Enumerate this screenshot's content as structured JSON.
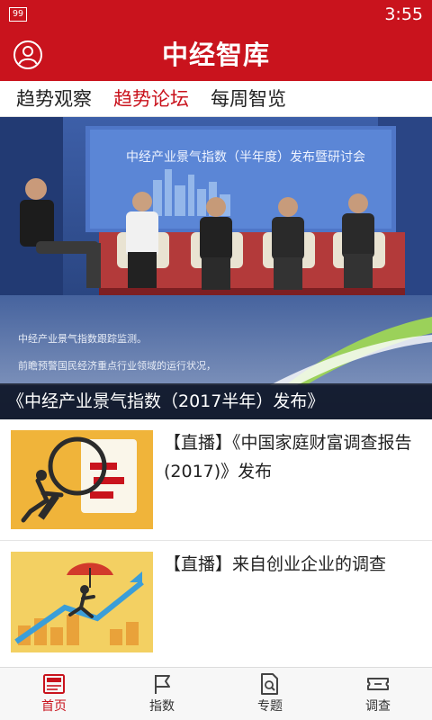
{
  "status_bar": {
    "badge": "99",
    "time": "3:55"
  },
  "header": {
    "title": "中经智库",
    "avatar_icon": "user-circle-icon"
  },
  "tabs": [
    {
      "label": "趋势观察",
      "active": false
    },
    {
      "label": "趋势论坛",
      "active": true
    },
    {
      "label": "每周智览",
      "active": false
    }
  ],
  "hero": {
    "caption": "《中经产业景气指数（2017半年）发布》",
    "screen_title": "中经产业景气指数（半年度）发布暨研讨会",
    "subtext_line1": "中经产业景气指数跟踪监测。",
    "subtext_line2": "前瞻预警国民经济重点行业领域的运行状况，"
  },
  "articles": [
    {
      "title": "【直播】《中国家庭财富调查报告(2017)》发布",
      "thumb_icon": "magnifier-illustration"
    },
    {
      "title": "【直播】来自创业企业的调查",
      "thumb_icon": "umbrella-growth-illustration"
    }
  ],
  "bottom_nav": [
    {
      "label": "首页",
      "icon": "news-icon",
      "active": true
    },
    {
      "label": "指数",
      "icon": "flag-icon",
      "active": false
    },
    {
      "label": "专题",
      "icon": "document-search-icon",
      "active": false
    },
    {
      "label": "调查",
      "icon": "survey-ticket-icon",
      "active": false
    }
  ],
  "colors": {
    "brand_red": "#c9131d",
    "text_dark": "#222222",
    "nav_bg": "#f7f7f7"
  }
}
